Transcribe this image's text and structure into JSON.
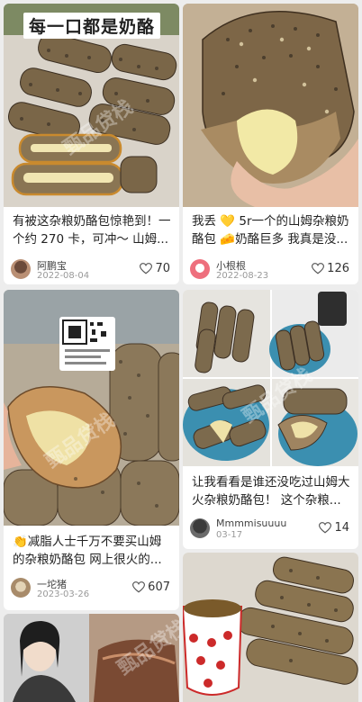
{
  "watermark": "甄品贷栈",
  "cards": [
    {
      "overlay_text": "每一口都是奶酪",
      "title": "有被这杂粮奶酪包惊艳到！一个约 270 卡，可冲～ 山姆...",
      "user": "阿鹏宝",
      "date": "2022-08-04",
      "likes": "70"
    },
    {
      "title": "我丢 💛 5r一个的山姆杂粮奶酪包 🧀奶酪巨多 我真是没...",
      "user": "小根根",
      "date": "2022-08-23",
      "likes": "126"
    },
    {
      "title": "👏减脂人士千万不要买山姆的杂粮奶酪包 网上很火的...",
      "user": "一坨猪",
      "date": "2023-03-26",
      "likes": "607"
    },
    {
      "title": "让我看看是谁还没吃过山姆大火杂粮奶酪包！ 这个杂粮...",
      "user": "Mmmmisuuuu",
      "date": "03-17",
      "likes": "14"
    }
  ],
  "icons": {
    "like": "heart-outline-icon"
  },
  "colors": {
    "accent": "#c98a2e",
    "text": "#222222",
    "meta": "#999999"
  }
}
